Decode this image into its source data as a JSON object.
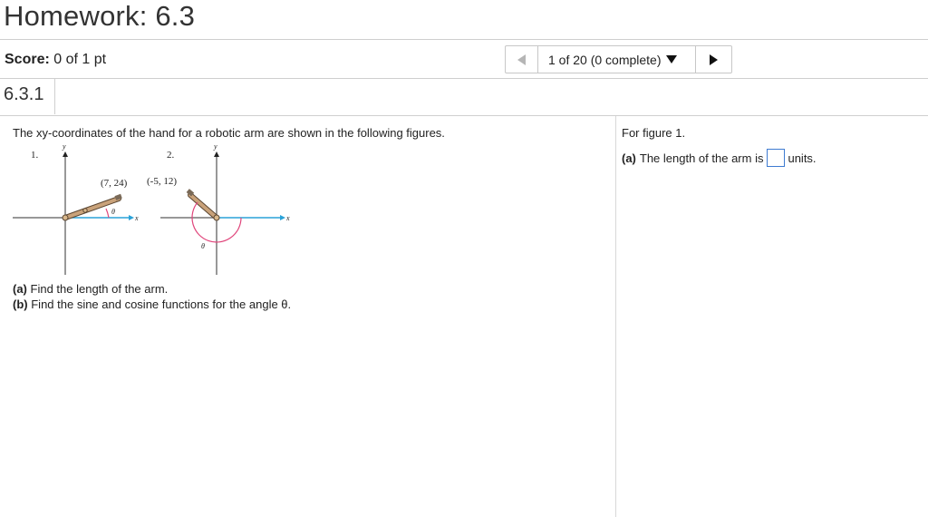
{
  "header": {
    "title": "Homework: 6.3"
  },
  "score": {
    "label": "Score:",
    "value": "0 of 1 pt"
  },
  "nav": {
    "position": "1 of 20 (0 complete)"
  },
  "question": {
    "number": "6.3.1",
    "intro": "The xy-coordinates of the hand for a robotic arm are shown in the following figures.",
    "part_a": "(a)",
    "part_a_text": "Find the length of the arm.",
    "part_b": "(b)",
    "part_b_text": "Find the sine and cosine functions for the angle θ."
  },
  "figure": {
    "fig1_label": "1.",
    "fig2_label": "2.",
    "fig1_point": "(7, 24)",
    "fig2_point": "(-5, 12)",
    "axis_x": "x",
    "axis_y": "y",
    "angle": "θ"
  },
  "answer": {
    "for_figure": "For figure 1.",
    "part_label": "(a)",
    "prompt": "The length of the arm is",
    "units": "units.",
    "value": ""
  },
  "colors": {
    "axis_blue": "#2aa2d8",
    "angle_pink": "#e0457b",
    "arm_tan": "#c9a27a",
    "answer_border": "#3e7bd1"
  }
}
